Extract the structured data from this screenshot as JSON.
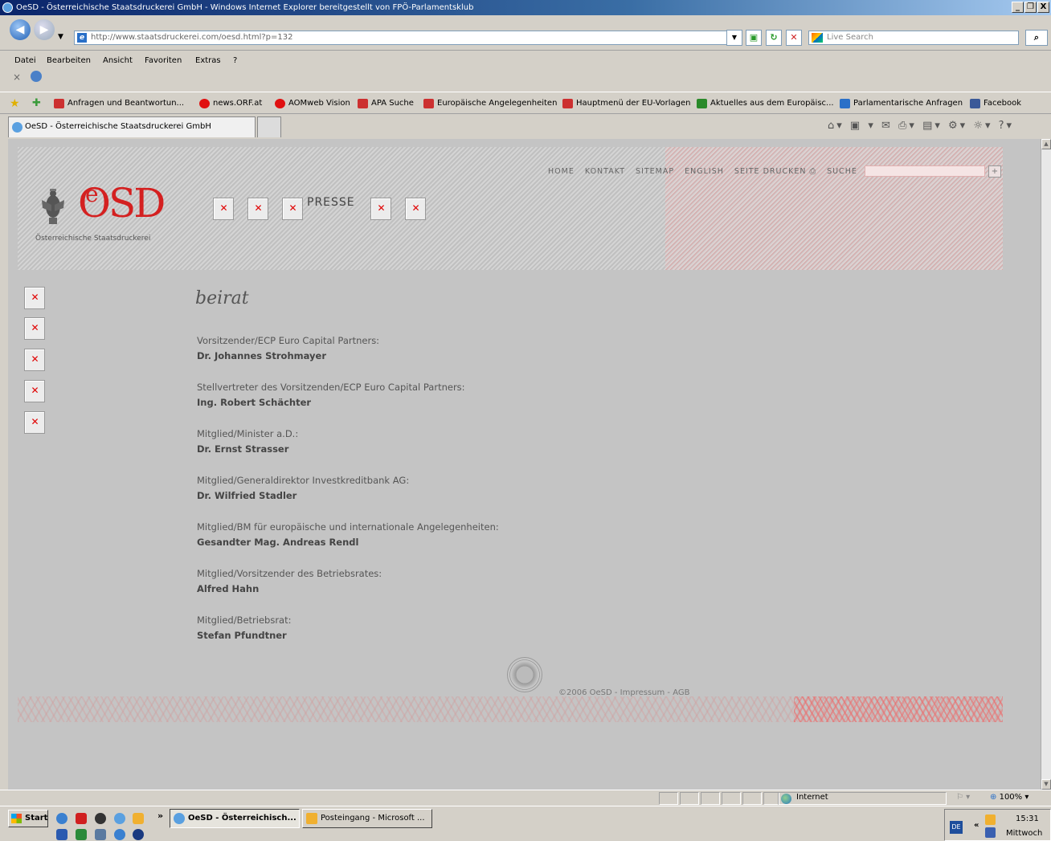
{
  "window": {
    "title": "OeSD - Österreichische Staatsdruckerei GmbH - Windows Internet Explorer bereitgestellt von FPÖ-Parlamentsklub",
    "controls": [
      "_",
      "❐",
      "X"
    ]
  },
  "address_bar": {
    "url": "http://www.staatsdruckerei.com/oesd.html?p=132",
    "search_placeholder": "Live Search"
  },
  "menu": [
    "Datei",
    "Bearbeiten",
    "Ansicht",
    "Favoriten",
    "Extras",
    "?"
  ],
  "favorites": [
    {
      "label": "Anfragen und Beantwortun...",
      "color": "#cc3030"
    },
    {
      "label": "news.ORF.at",
      "color": "#e01010"
    },
    {
      "label": "AOMweb Vision",
      "color": "#e01010"
    },
    {
      "label": "APA Suche",
      "color": "#cc3030"
    },
    {
      "label": "Europäische Angelegenheiten",
      "color": "#cc3030"
    },
    {
      "label": "Hauptmenü der EU-Vorlagen",
      "color": "#cc3030"
    },
    {
      "label": "Aktuelles aus dem Europäisc...",
      "color": "#2a8a2a"
    },
    {
      "label": "Parlamentarische Anfragen",
      "color": "#2a70c8"
    },
    {
      "label": "Facebook",
      "color": "#3b5998"
    }
  ],
  "tab": {
    "label": "OeSD - Österreichische Staatsdruckerei GmbH"
  },
  "site": {
    "logo_text": "OSD",
    "logo_sub": "Österreichische  Staatsdruckerei",
    "nav_presse": "PRESSE",
    "topnav": [
      "HOME",
      "KONTAKT",
      "SITEMAP",
      "ENGLISH",
      "SEITE DRUCKEN ⎙",
      "SUCHE"
    ],
    "heading": "beirat",
    "members": [
      {
        "role": "Vorsitzender/ECP Euro Capital Partners:",
        "name": "Dr. Johannes Strohmayer"
      },
      {
        "role": "Stellvertreter des Vorsitzenden/ECP Euro Capital Partners:",
        "name": "Ing. Robert Schächter"
      },
      {
        "role": "Mitglied/Minister a.D.:",
        "name": "Dr. Ernst Strasser"
      },
      {
        "role": "Mitglied/Generaldirektor Investkreditbank AG:",
        "name": "Dr. Wilfried Stadler"
      },
      {
        "role": "Mitglied/BM für europäische und internationale Angelegenheiten:",
        "name": "Gesandter Mag. Andreas Rendl"
      },
      {
        "role": "Mitglied/Vorsitzender des Betriebsrates:",
        "name": "Alfred Hahn"
      },
      {
        "role": "Mitglied/Betriebsrat:",
        "name": "Stefan Pfundtner"
      }
    ],
    "copyright": "©2006 OeSD - Impressum - AGB"
  },
  "status_bar": {
    "zone": "Internet",
    "zoom": "100%"
  },
  "taskbar": {
    "start": "Start",
    "tasks": [
      {
        "label": "OeSD - Österreichisch...",
        "active": true
      },
      {
        "label": "Posteingang - Microsoft ...",
        "active": false
      }
    ],
    "lang": "DE",
    "time": "15:31",
    "day": "Mittwoch"
  }
}
